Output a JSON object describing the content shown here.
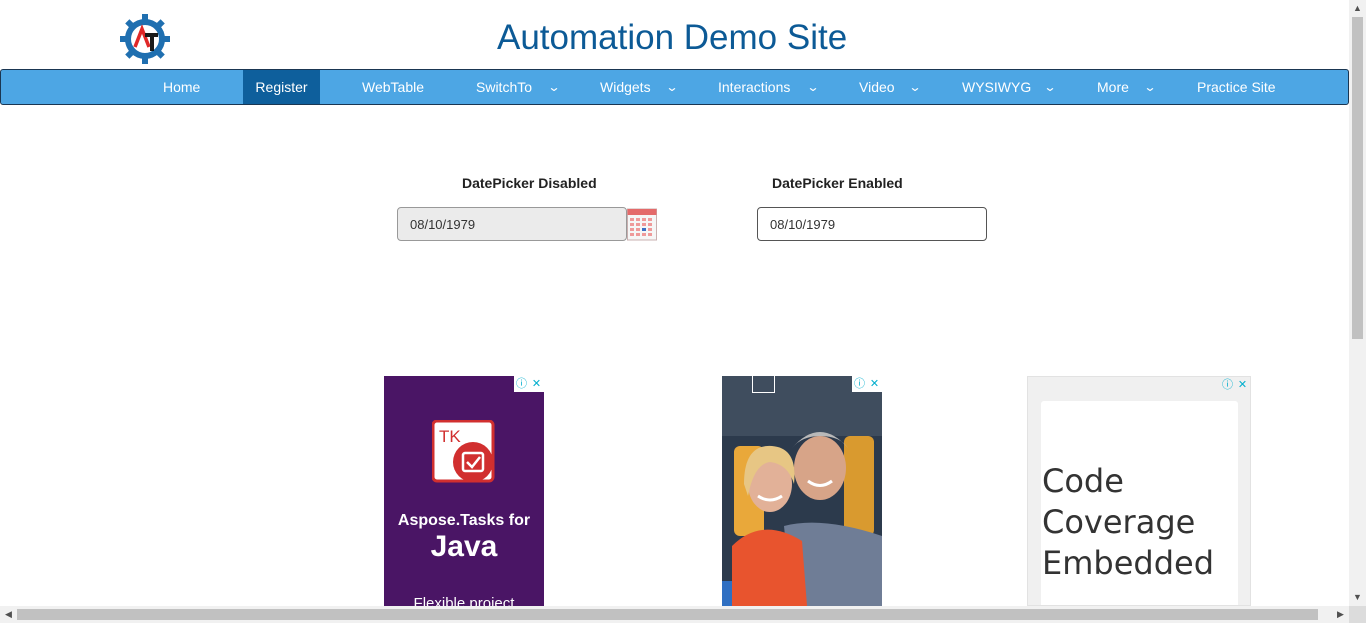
{
  "header": {
    "title": "Automation Demo Site",
    "logo_icon": "gear-logo-icon"
  },
  "nav": {
    "items": [
      {
        "label": "Home",
        "dropdown": false,
        "active": false
      },
      {
        "label": "Register",
        "dropdown": false,
        "active": true
      },
      {
        "label": "WebTable",
        "dropdown": false,
        "active": false
      },
      {
        "label": "SwitchTo",
        "dropdown": true,
        "active": false
      },
      {
        "label": "Widgets",
        "dropdown": true,
        "active": false
      },
      {
        "label": "Interactions",
        "dropdown": true,
        "active": false
      },
      {
        "label": "Video",
        "dropdown": true,
        "active": false
      },
      {
        "label": "WYSIWYG",
        "dropdown": true,
        "active": false
      },
      {
        "label": "More",
        "dropdown": true,
        "active": false
      },
      {
        "label": "Practice Site",
        "dropdown": false,
        "active": false
      }
    ],
    "chevron": "⌄",
    "colors": {
      "bar": "#4da6e4",
      "active": "#0e5f9c"
    }
  },
  "datepicker": {
    "disabled": {
      "label": "DatePicker Disabled",
      "value": "08/10/1979"
    },
    "enabled": {
      "label": "DatePicker Enabled",
      "value": "08/10/1979"
    },
    "calendar_icon": "calendar-icon"
  },
  "ads": {
    "info_glyph": "ⓘ",
    "close_glyph": "✕",
    "ad1": {
      "logo_text": "TK",
      "line1": "Aspose.Tasks for",
      "line2": "Java",
      "line3": "Flexible project"
    },
    "ad3": {
      "lines": [
        "Code",
        "Coverage",
        "Embedded"
      ]
    }
  },
  "scrollbars": {
    "up": "▲",
    "down": "▼",
    "left": "◀",
    "right": "▶"
  }
}
